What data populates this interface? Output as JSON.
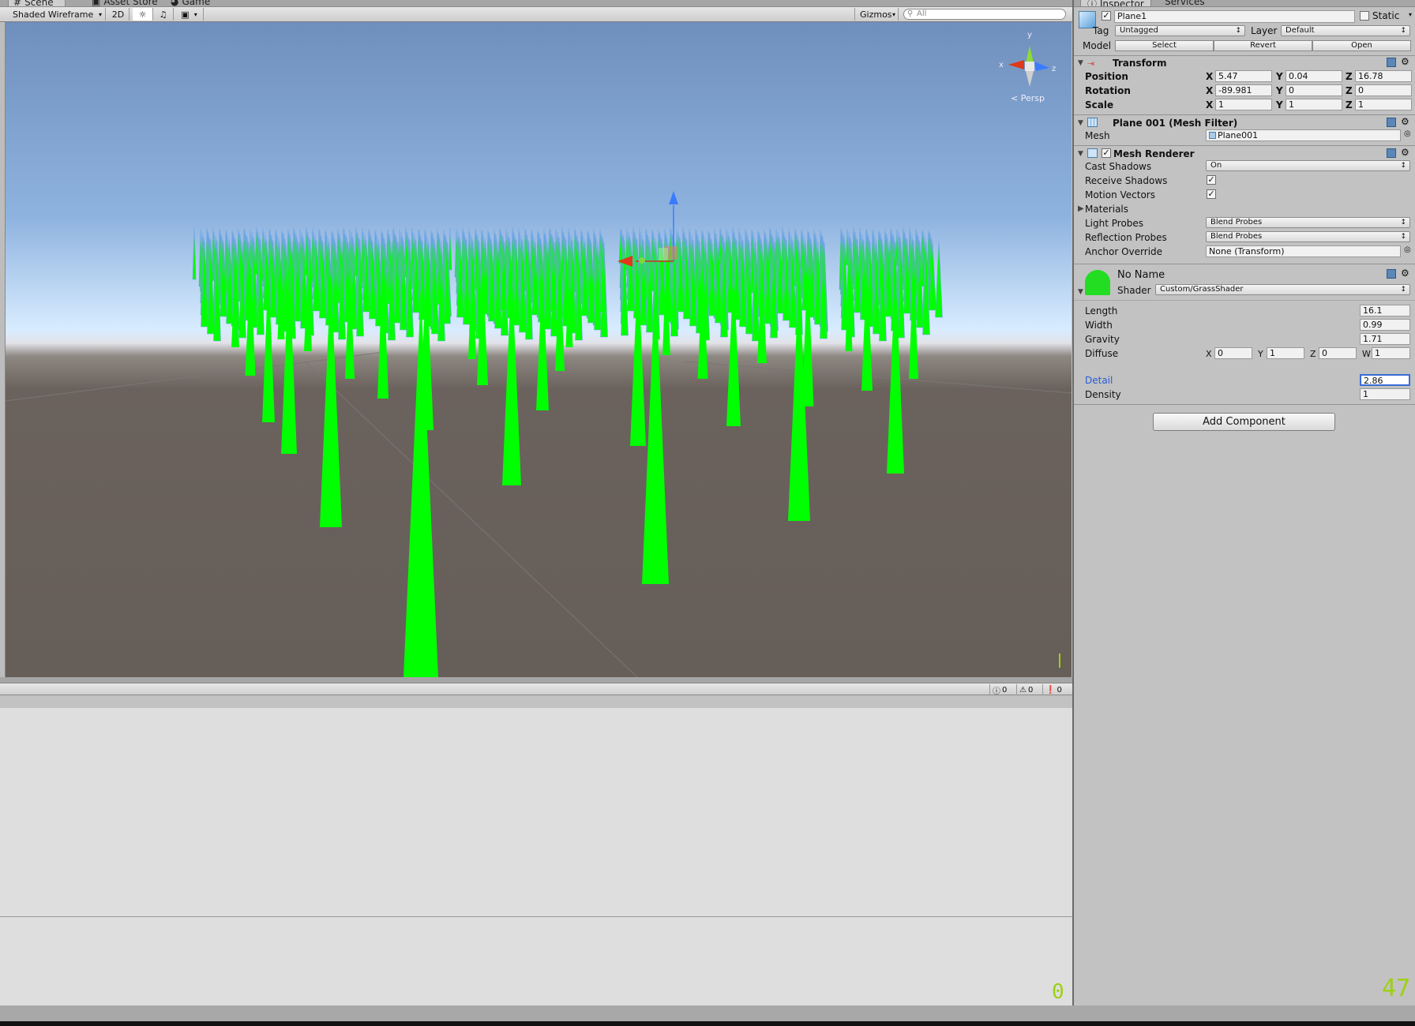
{
  "scene_tabs": [
    {
      "label": "Scene",
      "icon": "hash-icon"
    },
    {
      "label": "Asset Store",
      "icon": "shop-icon"
    },
    {
      "label": "Game",
      "icon": "pacman-icon"
    }
  ],
  "scene_toolbar": {
    "draw_mode": "Shaded Wireframe",
    "mode_2d": "2D",
    "gizmos": "Gizmos",
    "search_placeholder": "All"
  },
  "viewport": {
    "gizmo_axes": [
      "y",
      "x",
      "z"
    ],
    "projection": "Persp",
    "grass_color": "#00ff00",
    "sky_color": "#8fb3df",
    "ground_color": "#665e58"
  },
  "console": {
    "info_count": "0",
    "warning_count": "0",
    "error_count": "0"
  },
  "inspector_tabs": [
    {
      "label": "Inspector",
      "icon": "info-icon"
    },
    {
      "label": "Services"
    }
  ],
  "inspector": {
    "object_name": "Plane1",
    "active": true,
    "static_label": "Static",
    "tag_label": "Tag",
    "tag_value": "Untagged",
    "layer_label": "Layer",
    "layer_value": "Default",
    "model_label": "Model",
    "model_buttons": [
      "Select",
      "Revert",
      "Open"
    ],
    "transform": {
      "title": "Transform",
      "rows": [
        {
          "label": "Position",
          "x": "5.47",
          "y": "0.04",
          "z": "16.78"
        },
        {
          "label": "Rotation",
          "x": "-89.981",
          "y": "0",
          "z": "0"
        },
        {
          "label": "Scale",
          "x": "1",
          "y": "1",
          "z": "1"
        }
      ]
    },
    "mesh_filter": {
      "title": "Plane 001 (Mesh Filter)",
      "mesh_label": "Mesh",
      "mesh_value": "Plane001"
    },
    "mesh_renderer": {
      "title": "Mesh Renderer",
      "cast_shadows_label": "Cast Shadows",
      "cast_shadows_value": "On",
      "receive_shadows_label": "Receive Shadows",
      "motion_vectors_label": "Motion Vectors",
      "materials_label": "Materials",
      "light_probes_label": "Light Probes",
      "light_probes_value": "Blend Probes",
      "reflection_probes_label": "Reflection Probes",
      "reflection_probes_value": "Blend Probes",
      "anchor_override_label": "Anchor Override",
      "anchor_override_value": "None (Transform)"
    },
    "material": {
      "name": "No Name",
      "shader_label": "Shader",
      "shader_value": "Custom/GrassShader",
      "props": [
        {
          "label": "Length",
          "value": "16.1"
        },
        {
          "label": "Width",
          "value": "0.99"
        },
        {
          "label": "Gravity",
          "value": "1.71"
        }
      ],
      "diffuse_label": "Diffuse",
      "diffuse": {
        "x": "0",
        "y": "1",
        "z": "0",
        "w": "1"
      },
      "detail_label": "Detail",
      "detail_value": "2.86",
      "density_label": "Density",
      "density_value": "1"
    },
    "add_component": "Add Component"
  },
  "fps_left": "0",
  "fps_right": "47"
}
